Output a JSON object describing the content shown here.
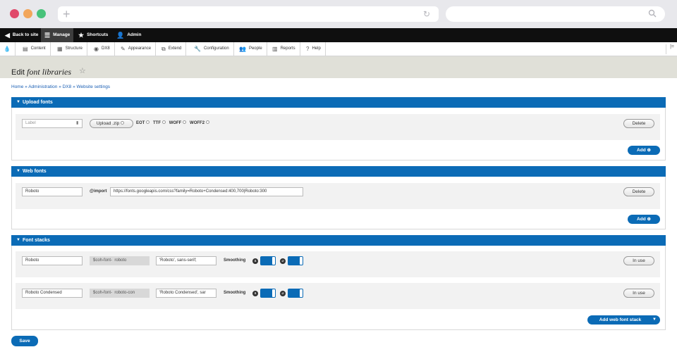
{
  "toolbar": {
    "back": "Back to site",
    "manage": "Manage",
    "shortcuts": "Shortcuts",
    "admin": "Admin"
  },
  "tray": {
    "items": [
      "Content",
      "Structure",
      "DX8",
      "Appearance",
      "Extend",
      "Configuration",
      "People",
      "Reports",
      "Help"
    ]
  },
  "page": {
    "title_prefix": "Edit",
    "title_em": "font libraries"
  },
  "breadcrumb": "Home » Administration » DX8 » Website settings",
  "upload": {
    "title": "Upload fonts",
    "label_placeholder": "Label",
    "upload_button": "Upload .zip",
    "formats": [
      "EOT",
      "TTF",
      "WOFF",
      "WOFF2"
    ],
    "delete": "Delete",
    "add": "Add"
  },
  "webfonts": {
    "title": "Web fonts",
    "name_value": "Roboto",
    "import_label": "@import",
    "import_value": "https://fonts.googleapis.com/css?family=Roboto+Condensed:400,700|Roboto:300",
    "delete": "Delete",
    "add": "Add"
  },
  "stacks": {
    "title": "Font stacks",
    "rows": [
      {
        "name": "Roboto",
        "var_prefix": "$coh-font-",
        "var_value": "roboto",
        "stack": "'Roboto', sans-serif;",
        "smoothing": "Smoothing",
        "status": "In use"
      },
      {
        "name": "Roboto Condensed",
        "var_prefix": "$coh-font-",
        "var_value": "roboto-con",
        "stack": "'Roboto Condensed', sar",
        "smoothing": "Smoothing",
        "status": "In use"
      }
    ],
    "add_stack": "Add web font stack"
  },
  "save": "Save",
  "colors": {
    "accent": "#0b6bb6",
    "toolbar": "#0f0f0f"
  }
}
